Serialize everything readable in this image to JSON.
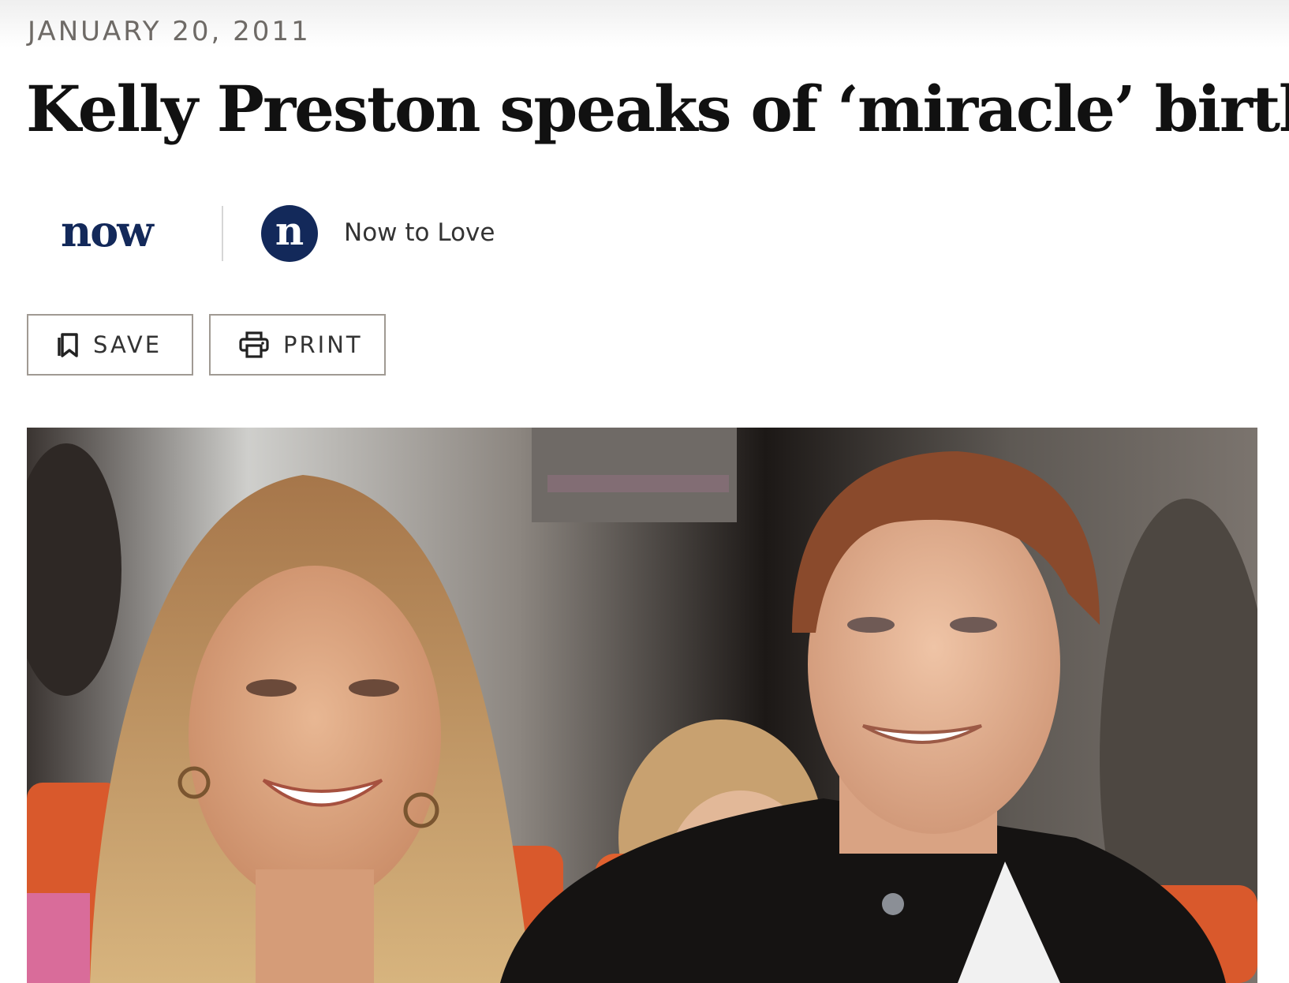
{
  "article": {
    "date": "JANUARY 20, 2011",
    "headline": "Kelly Preston speaks of ‘miracle’ birth"
  },
  "byline": {
    "brand_logo_text": "now",
    "avatar_letter": "n",
    "author": "Now to Love"
  },
  "actions": {
    "save_label": "SAVE",
    "print_label": "PRINT"
  },
  "icons": {
    "save": "bookmark-icon",
    "print": "printer-icon"
  },
  "colors": {
    "brand": "#13295a",
    "date_text": "#6e6a66",
    "headline_text": "#111111",
    "button_border": "#a09a93"
  }
}
